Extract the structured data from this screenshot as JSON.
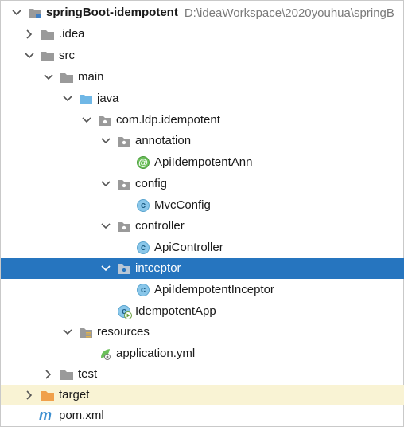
{
  "project_root": {
    "name": "springBoot-idempotent",
    "path": "D:\\ideaWorkspace\\2020youhua\\springB"
  },
  "nodes": {
    "idea": ".idea",
    "src": "src",
    "main": "main",
    "java": "java",
    "package": "com.ldp.idempotent",
    "annotation": "annotation",
    "annotation_class": "ApiIdempotentAnn",
    "config": "config",
    "config_class": "MvcConfig",
    "controller": "controller",
    "controller_class": "ApiController",
    "intceptor": "intceptor",
    "intceptor_class": "ApiIdempotentInceptor",
    "app_class": "IdempotentApp",
    "resources": "resources",
    "resources_file": "application.yml",
    "test": "test",
    "target": "target",
    "pom": "pom.xml"
  },
  "icon_glyphs": {
    "class": "c",
    "annotation": "@",
    "maven": "m"
  },
  "colors": {
    "selection": "#2675bf",
    "target_highlight": "#f9f3d4",
    "folder": "#9a9a9a",
    "source_folder": "#6fb7e6",
    "excluded_folder": "#f0a04b",
    "class_icon": "#8ac7ea",
    "annotation_icon": "#6bbf5a"
  }
}
